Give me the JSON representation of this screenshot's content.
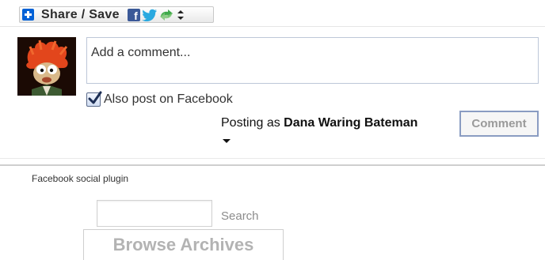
{
  "share_widget": {
    "label": "Share / Save",
    "icons": [
      "plus-icon",
      "facebook-icon",
      "twitter-icon",
      "share-icon",
      "up-down-arrows-icon"
    ]
  },
  "comment_form": {
    "avatar_alt": "user avatar",
    "placeholder": "Add a comment...",
    "also_post_label": "Also post on Facebook",
    "also_post_checked": true,
    "posting_as_prefix": "Posting as",
    "posting_as_name": "Dana Waring Bateman",
    "submit_label": "Comment"
  },
  "footer": {
    "plugin_note": "Facebook social plugin"
  },
  "search": {
    "value": "",
    "button_label": "Search"
  },
  "browse_archives_label": "Browse Archives",
  "colors": {
    "facebook_blue": "#3b5998",
    "plus_blue": "#0061d6",
    "twitter_blue": "#2aa9e0",
    "share_green": "#3fa94b",
    "input_border": "#bdc7d8"
  }
}
